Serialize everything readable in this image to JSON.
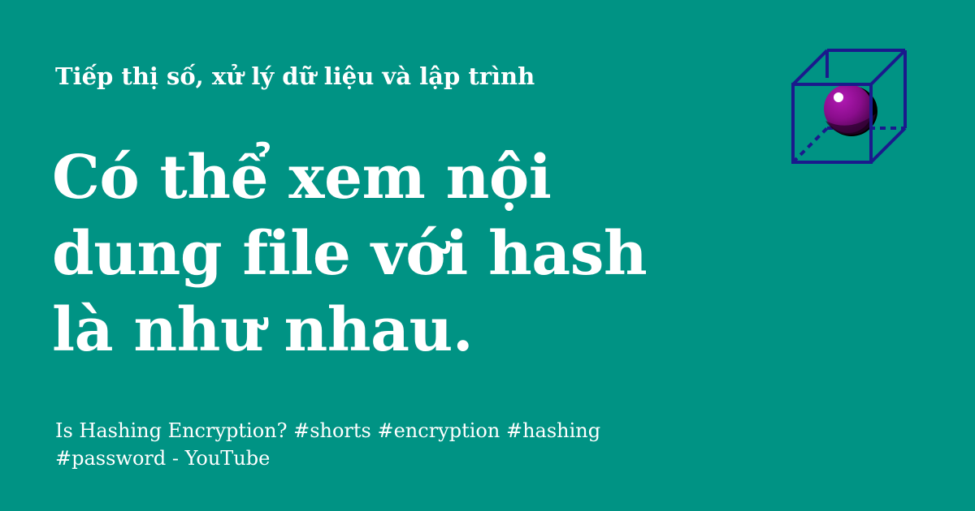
{
  "header": {
    "tagline": "Tiếp thị số, xử lý dữ liệu và lập trình"
  },
  "main": {
    "headline_lines": [
      "Có thể xem nội",
      "dung file với hash",
      "là như nhau."
    ]
  },
  "footer": {
    "source_lines": [
      "Is Hashing Encryption? #shorts #encryption #hashing",
      "#password - YouTube"
    ]
  },
  "logo": {
    "icon": "cube-sphere-icon"
  },
  "colors": {
    "background": "#009384",
    "text": "#ffffff",
    "cube_stroke": "#1a1a8c",
    "sphere": "#8a0d8c"
  }
}
